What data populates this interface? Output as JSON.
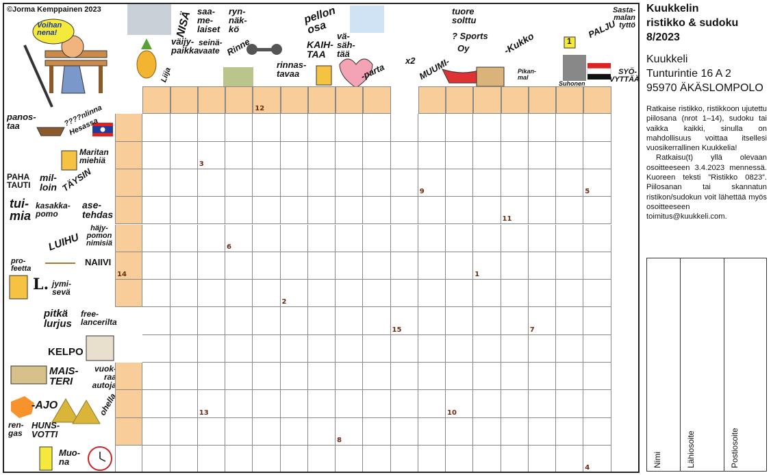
{
  "puzzle": {
    "copyright": "©Jorma Kemppainen 2023",
    "grid_cols": 18,
    "grid_rows": 13,
    "top_clues": [
      {
        "id": "voihan",
        "text": "Voihan nena!"
      },
      {
        "id": "nisa",
        "text": "NISÄ"
      },
      {
        "id": "saamelaiset",
        "text": "saa-me-laiset"
      },
      {
        "id": "rynnakko",
        "text": "ryn-näk-kö"
      },
      {
        "id": "pellon-osa",
        "text": "pellon osa"
      },
      {
        "id": "kaihtaa",
        "text": "KAIH-TAA"
      },
      {
        "id": "vasahtaa",
        "text": "vä-säh-tää"
      },
      {
        "id": "tuore-solttu",
        "text": "tuore solttu"
      },
      {
        "id": "sports",
        "text": "? Sports"
      },
      {
        "id": "oy",
        "text": "Oy"
      },
      {
        "id": "kukko",
        "text": "-Kukko"
      },
      {
        "id": "sastamalan-tytto",
        "text": "Sasta-malan tyttö"
      },
      {
        "id": "palju",
        "text": "PALJU"
      },
      {
        "id": "vaijypaikka",
        "text": "väijy-paikka"
      },
      {
        "id": "seinavaate",
        "text": "seinä-vaate"
      },
      {
        "id": "rinne",
        "text": "Rinne"
      },
      {
        "id": "liija",
        "text": "Liija"
      },
      {
        "id": "rinnastavaa",
        "text": "rinnas-tavaa"
      },
      {
        "id": "parta",
        "text": "-parta"
      },
      {
        "id": "x2",
        "text": "x2"
      },
      {
        "id": "muumi",
        "text": "MUUMI-"
      },
      {
        "id": "pikanmal",
        "text": "Pikan-mal"
      },
      {
        "id": "suhonen",
        "text": "Suhonen"
      },
      {
        "id": "syovyttaa",
        "text": "SYÖ-VYTTÄÄ"
      },
      {
        "id": "sign-1",
        "text": "1"
      }
    ],
    "left_clues": [
      {
        "id": "panostaa",
        "text": "panos-taa"
      },
      {
        "id": "nlinna",
        "text": "????nlinna"
      },
      {
        "id": "hesassa",
        "text": "Hesassa"
      },
      {
        "id": "maritan-miehia",
        "text": "Maritan miehiä"
      },
      {
        "id": "paha-tauti",
        "text": "PAHA TAUTI"
      },
      {
        "id": "milloin",
        "text": "mil-loin"
      },
      {
        "id": "taysin",
        "text": "TÄYSIN"
      },
      {
        "id": "tuimia",
        "text": "tui-mia"
      },
      {
        "id": "kasakkapomo",
        "text": "kasakka-pomo"
      },
      {
        "id": "asetehdas",
        "text": "ase-tehdas"
      },
      {
        "id": "luihu",
        "text": "LUIHU"
      },
      {
        "id": "hajypomon",
        "text": "häjy-pomon nimisiä"
      },
      {
        "id": "profeetta",
        "text": "pro-feetta"
      },
      {
        "id": "naiivi",
        "text": "NAIIVI"
      },
      {
        "id": "l-letter",
        "text": "L."
      },
      {
        "id": "jymiseva",
        "text": "jymi-sevä"
      },
      {
        "id": "pitka-lurjus",
        "text": "pitkä lurjus"
      },
      {
        "id": "freelancerilta",
        "text": "free-lancerilta"
      },
      {
        "id": "kelpo",
        "text": "KELPO"
      },
      {
        "id": "maisteri",
        "text": "MAIS-TERI"
      },
      {
        "id": "vuokraautoja",
        "text": "vuok-raa autoja"
      },
      {
        "id": "ajo",
        "text": "-AJO"
      },
      {
        "id": "ohella",
        "text": "ohella"
      },
      {
        "id": "rengas",
        "text": "ren-gas"
      },
      {
        "id": "hunsvotti",
        "text": "HUNS-VOTTI"
      },
      {
        "id": "muona",
        "text": "Muo-na"
      }
    ],
    "cell_numbers": [
      {
        "id": "n12",
        "text": "12"
      },
      {
        "id": "n3",
        "text": "3"
      },
      {
        "id": "n9",
        "text": "9"
      },
      {
        "id": "n5",
        "text": "5"
      },
      {
        "id": "n11",
        "text": "11"
      },
      {
        "id": "n6",
        "text": "6"
      },
      {
        "id": "n14",
        "text": "14"
      },
      {
        "id": "n1",
        "text": "1"
      },
      {
        "id": "n2",
        "text": "2"
      },
      {
        "id": "n15",
        "text": "15"
      },
      {
        "id": "n7",
        "text": "7"
      },
      {
        "id": "n13",
        "text": "13"
      },
      {
        "id": "n10",
        "text": "10"
      },
      {
        "id": "n8",
        "text": "8"
      },
      {
        "id": "n4",
        "text": "4"
      }
    ]
  },
  "sidebar": {
    "title_lines": [
      "Kuukkelin",
      "ristikko & sudoku",
      "8/2023"
    ],
    "address_lines": [
      "Kuukkeli",
      "Tunturintie 16 A 2",
      "95970 ÄKÄSLOMPOLO"
    ],
    "paragraph_1": "Ratkaise ristikko, ristikkoon ujutettu piilosana (nrot 1–14), sudoku tai vaikka kaikki, sinulla on mahdollisuus voittaa itsellesi vuosikerrallinen Kuukkelia!",
    "paragraph_2": "Ratkaisu(t) yllä olevaan osoitteeseen 3.4.2023 mennessä. Kuoreen teksti ”Ristikko 0823”. Piilosanan tai skannatun ristikon/sudokun voit lähettää myös osoitteeseen toimitus@kuukkeli.com.",
    "form_labels": [
      "Nimi",
      "Lähiosoite",
      "Postiosoite"
    ]
  }
}
